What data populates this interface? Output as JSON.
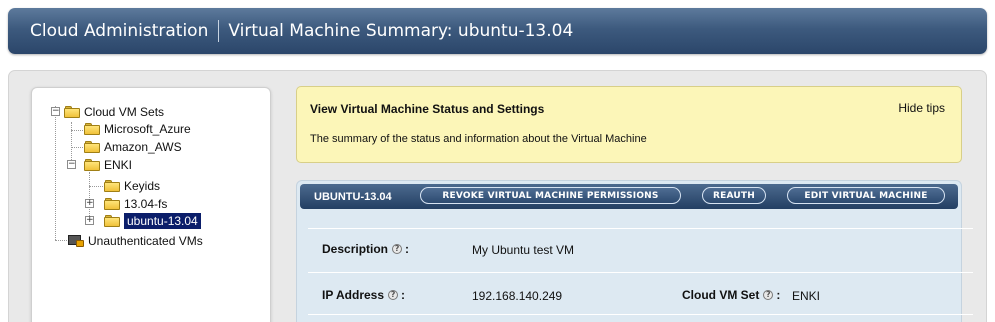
{
  "header": {
    "app_title": "Cloud Administration",
    "page_title": "Virtual Machine Summary: ubuntu-13.04"
  },
  "tree": {
    "root": "Cloud VM Sets",
    "items": [
      {
        "label": "Microsoft_Azure"
      },
      {
        "label": "Amazon_AWS"
      },
      {
        "label": "ENKI"
      },
      {
        "label": "Keyids"
      },
      {
        "label": "13.04-fs"
      },
      {
        "label": "ubuntu-13.04",
        "selected": true
      }
    ],
    "unauthenticated": "Unauthenticated VMs"
  },
  "tips": {
    "title": "View Virtual Machine Status and Settings",
    "hide_label": "Hide tips",
    "description": "The summary of the status and information about the Virtual Machine"
  },
  "vm": {
    "name": "UBUNTU-13.04",
    "buttons": {
      "revoke": "REVOKE VIRTUAL MACHINE PERMISSIONS",
      "reauth": "REAUTH",
      "edit": "EDIT VIRTUAL MACHINE"
    },
    "fields": {
      "description_label": "Description",
      "description_value": "My Ubuntu test VM",
      "ip_label": "IP Address",
      "ip_value": "192.168.140.249",
      "cloud_set_label": "Cloud VM Set",
      "cloud_set_value": "ENKI"
    }
  },
  "icons": {
    "help": "?",
    "expand": "+",
    "collapse": "−"
  }
}
